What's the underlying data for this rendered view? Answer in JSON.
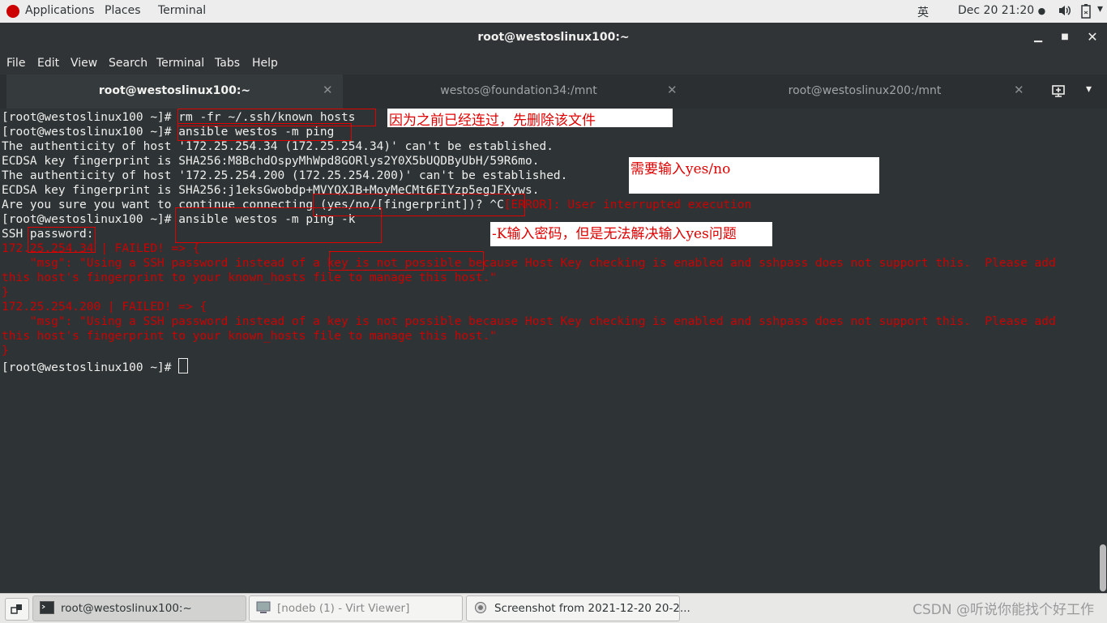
{
  "topbar": {
    "applications": "Applications",
    "places": "Places",
    "terminal": "Terminal",
    "input_method": "英",
    "datetime": "Dec 20  21:20",
    "icons": [
      "volume-icon",
      "battery-icon"
    ]
  },
  "window": {
    "title": "root@westoslinux100:~"
  },
  "menubar": [
    "File",
    "Edit",
    "View",
    "Search",
    "Terminal",
    "Tabs",
    "Help"
  ],
  "tabs": [
    {
      "label": "root@westoslinux100:~",
      "active": true
    },
    {
      "label": "westos@foundation34:/mnt",
      "active": false
    },
    {
      "label": "root@westoslinux200:/mnt",
      "active": false
    }
  ],
  "terminal": {
    "prompt": "[root@westoslinux100 ~]# ",
    "cmd1": "rm -fr ~/.ssh/known_hosts",
    "cmd2": "ansible westos -m ping",
    "l3": "The authenticity of host '172.25.254.34 (172.25.254.34)' can't be established.",
    "l4": "ECDSA key fingerprint is SHA256:M8BchdOspyMhWpd8GORlys2Y0X5bUQDByUbH/59R6mo.",
    "l5": "The authenticity of host '172.25.254.200 (172.25.254.200)' can't be established.",
    "l6": "ECDSA key fingerprint is SHA256:j1eksGwobdp+MVYQXJB+MoyMeCMt6FIYzp5egJFXyws.",
    "l7a": "Are you sure you want to continue connecting (yes/no/[fingerprint])? ^C",
    "l7b": "[ERROR]: User interrupted execution",
    "cmd3": "ansible westos -m ping -k",
    "l9": "SSH password:",
    "l10": "172.25.254.34 | FAILED! => {",
    "l11": "    \"msg\": \"Using a SSH password instead of a key is not possible because Host Key checking is enabled and sshpass does not support this.  Please add",
    "l12": "this host's fingerprint to your known_hosts file to manage this host.\"",
    "l13": "}",
    "l14": "172.25.254.200 | FAILED! => {",
    "l15": "    \"msg\": \"Using a SSH password instead of a key is not possible because Host Key checking is enabled and sshpass does not support this.  Please add",
    "l16": "this host's fingerprint to your known_hosts file to manage this host.\"",
    "l17": "}"
  },
  "annotations": {
    "note1": "因为之前已经连过，先删除该文件",
    "note2": "需要输入yes/no",
    "note3": "-K输入密码，但是无法解决输入yes问题"
  },
  "taskbar": {
    "items": [
      {
        "label": "root@westoslinux100:~",
        "active": true
      },
      {
        "label": "[nodeb (1) - Virt Viewer]",
        "active": false
      },
      {
        "label": "Screenshot from 2021-12-20 20-2...",
        "active": false
      }
    ],
    "watermark": "CSDN @听说你能找个好工作"
  },
  "colors": {
    "error_red": "#cc0000",
    "annotation_red": "#e00000",
    "terminal_bg": "#2e3436"
  }
}
